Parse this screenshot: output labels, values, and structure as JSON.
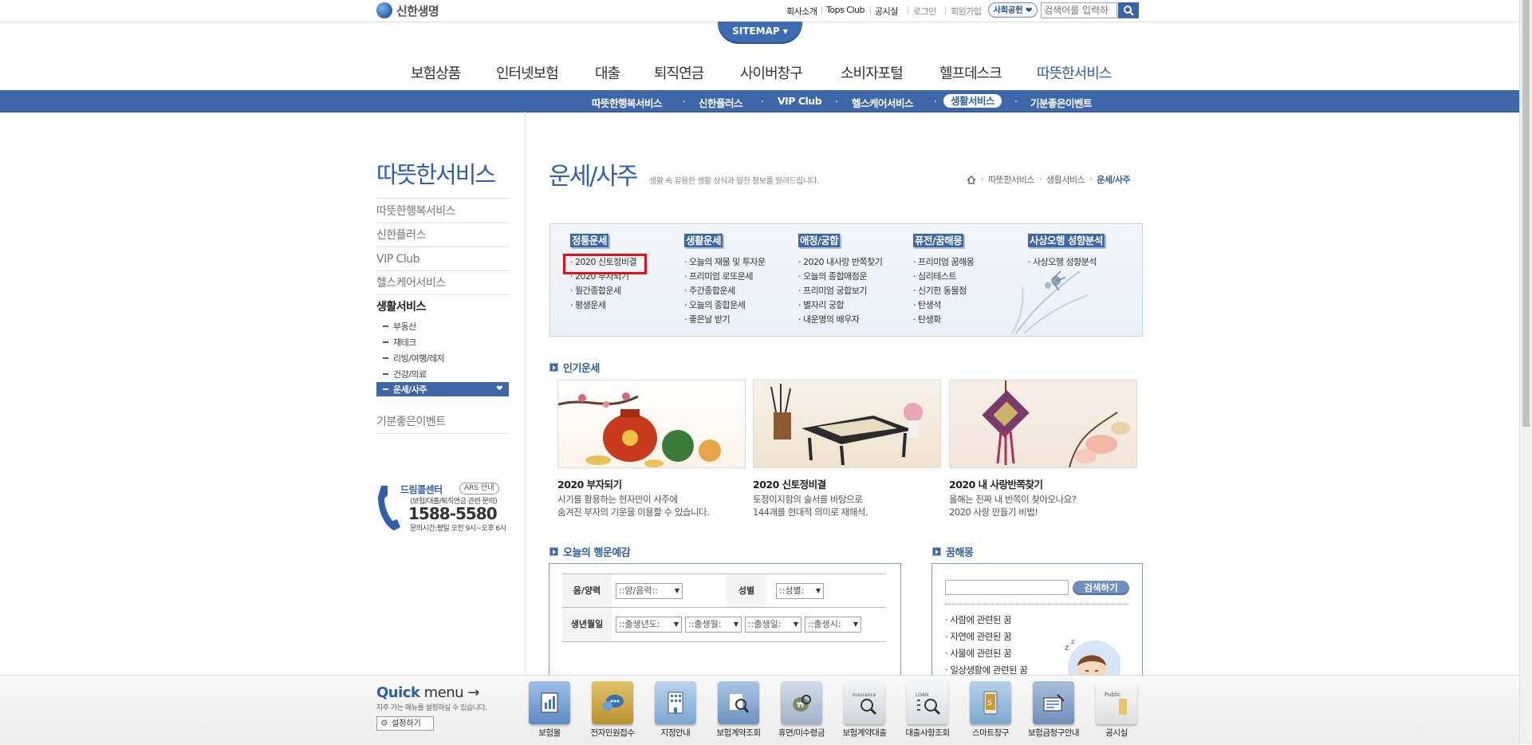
{
  "header": {
    "logo_text": "신한생명",
    "util_links": [
      "회사소개",
      "Tops Club",
      "공시실"
    ],
    "login": "로그인",
    "join": "회원가입",
    "social_btn": "사회공헌 ❤",
    "search_placeholder": "검색어를 입력하",
    "sitemap": "SITEMAP ▾"
  },
  "gnb": [
    "보험상품",
    "인터넷보험",
    "대출",
    "퇴직연금",
    "사이버창구",
    "소비자포털",
    "헬프데스크",
    "따뜻한서비스"
  ],
  "subnav": [
    "따뜻한행복서비스",
    "신한플러스",
    "VIP Club",
    "헬스케어서비스",
    "생활서비스",
    "기분좋은이벤트"
  ],
  "sidebar": {
    "title": "따뜻한서비스",
    "items": [
      "따뜻한행복서비스",
      "신한플러스",
      "VIP Club",
      "헬스케어서비스",
      "생활서비스"
    ],
    "subitems": [
      "부동산",
      "재테크",
      "리빙/여행/레저",
      "건강/의료",
      "운세/사주"
    ],
    "last_item": "기분좋은이벤트",
    "callcenter": {
      "title": "드림콜센터",
      "ars": "ARS 안내",
      "desc": "(보험/대출/퇴직연금 관련 문의)",
      "number": "1588-5580",
      "hours": "문의시간:평일 오전 9시~오후 6시"
    }
  },
  "content": {
    "title": "운세/사주",
    "desc": "생활 속 유용한 생활 상식과 알찬 정보를 알려드립니다.",
    "breadcrumb": [
      "따뜻한서비스",
      "생활서비스",
      "운세/사주"
    ]
  },
  "categories": [
    {
      "head": "정통운세",
      "links": [
        "2020 신토정비결",
        "2020 부자되기",
        "월간종합운세",
        "평생운세"
      ]
    },
    {
      "head": "생활운세",
      "links": [
        "오늘의 재물 및 투자운",
        "프리미엄 로또운세",
        "주간종합운세",
        "오늘의 종합운세",
        "좋은날 받기"
      ]
    },
    {
      "head": "애정/궁합",
      "links": [
        "2020 내사랑 반쪽찾기",
        "오늘의 종합애정운",
        "프리미엄 궁합보기",
        "별자리 궁합",
        "내운명의 배우자"
      ]
    },
    {
      "head": "퓨전/꿈해몽",
      "links": [
        "프리미엄 꿈해몽",
        "심리테스트",
        "신기한 동물점",
        "탄생석",
        "탄생화"
      ]
    },
    {
      "head": "사상오행 성향분석",
      "links": [
        "사상오행 성향분석"
      ]
    }
  ],
  "popular": {
    "heading": "인기운세",
    "cards": [
      {
        "title": "2020 부자되기",
        "desc1": "시기를 활용하는 현자만이 사주에",
        "desc2": "숨겨진 부자의 기운을 이용할 수 있습니다."
      },
      {
        "title": "2020 신토정비결",
        "desc1": "토정이지함의 술서를 바탕으로",
        "desc2": "144괘를 현대적 의미로 재해석."
      },
      {
        "title": "2020 내 사랑반쪽찾기",
        "desc1": "올해는 진짜 내 반쪽이 찾아오나요?",
        "desc2": "2020 사랑 만들기 비법!"
      }
    ]
  },
  "today": {
    "heading": "오늘의 행운예감",
    "label_calendar": "음/양력",
    "label_gender": "성별",
    "label_birth": "생년월일",
    "sel_calendar": "::양/음력::",
    "sel_gender": "::성별:",
    "sel_year": "::출생년도:",
    "sel_month": "::출생월:",
    "sel_day": "::출생일:",
    "sel_hour": "::출생시:"
  },
  "dream": {
    "heading": "꿈해몽",
    "search_btn": "검색하기",
    "items": [
      "사람에 관련된 꿈",
      "자연에 관련된 꿈",
      "사물에 관련된 꿈",
      "일상생활에 관련된 꿈"
    ]
  },
  "quick": {
    "title_bold": "Quick",
    "title_rest": " menu",
    "arrow": "→",
    "desc": "자주 가는 메뉴를 설정하실 수 있습니다.",
    "set_btn": "설정하기",
    "items": [
      {
        "label": "보험몰",
        "color": "#7ea7d8"
      },
      {
        "label": "전자민원접수",
        "color": "#c4a44a"
      },
      {
        "label": "지점안내",
        "color": "#8eb5da"
      },
      {
        "label": "보험계약조회",
        "color": "#87a9cf"
      },
      {
        "label": "휴면/미수령금",
        "color": "#b9c8d6"
      },
      {
        "label": "보험계약대출",
        "color": "#d9dde3"
      },
      {
        "label": "대출사항조회",
        "color": "#e4e6ea"
      },
      {
        "label": "스마트창구",
        "color": "#9fc0de"
      },
      {
        "label": "보험금청구안내",
        "color": "#8aa6c8"
      },
      {
        "label": "공시실",
        "color": "#ececec"
      }
    ]
  },
  "colors": {
    "brand": "#3d67a8",
    "highlight": "#e0101a"
  }
}
